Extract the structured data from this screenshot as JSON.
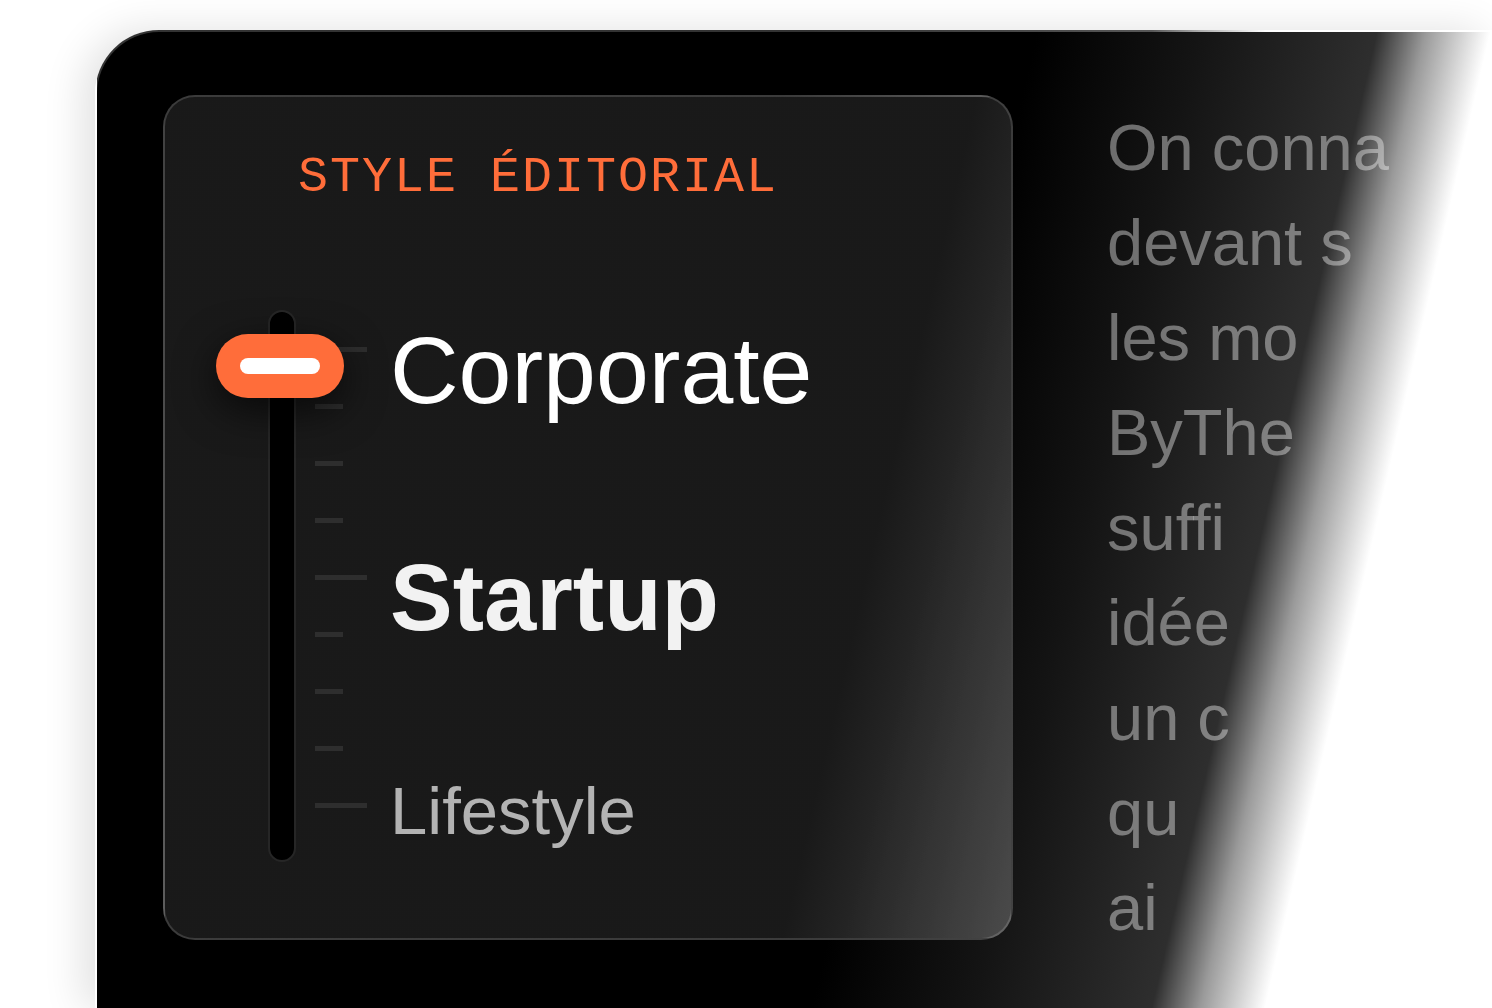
{
  "editorial_style": {
    "title": "STYLE ÉDITORIAL",
    "options": [
      {
        "label": "Corporate",
        "selected": true,
        "hovered": false
      },
      {
        "label": "Startup",
        "selected": false,
        "hovered": true
      },
      {
        "label": "Lifestyle",
        "selected": false,
        "hovered": false
      }
    ]
  },
  "side_text": {
    "lines": [
      "On conna",
      "devant s",
      "les mo",
      "ByThe",
      "suffi",
      "idée",
      "un c",
      "qu",
      "ai"
    ]
  }
}
